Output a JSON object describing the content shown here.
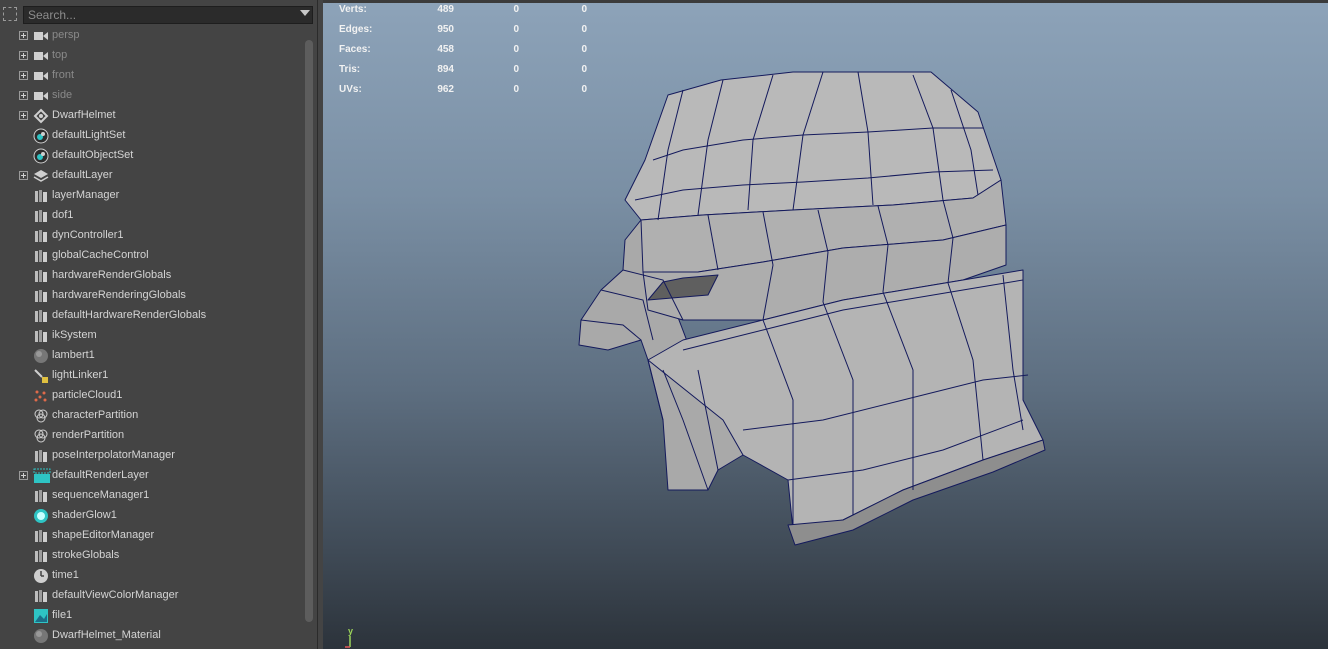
{
  "search": {
    "placeholder": "Search..."
  },
  "outliner": {
    "items": [
      {
        "label": "persp",
        "icon": "camera-icon",
        "expandable": true,
        "dim": true
      },
      {
        "label": "top",
        "icon": "camera-icon",
        "expandable": true,
        "dim": true
      },
      {
        "label": "front",
        "icon": "camera-icon",
        "expandable": true,
        "dim": true
      },
      {
        "label": "side",
        "icon": "camera-icon",
        "expandable": true,
        "dim": true
      },
      {
        "label": "DwarfHelmet",
        "icon": "transform-icon",
        "expandable": true,
        "dim": false
      },
      {
        "label": "defaultLightSet",
        "icon": "set-icon",
        "expandable": false,
        "dim": false
      },
      {
        "label": "defaultObjectSet",
        "icon": "set-icon",
        "expandable": false,
        "dim": false
      },
      {
        "label": "defaultLayer",
        "icon": "layer-icon",
        "expandable": true,
        "dim": false
      },
      {
        "label": "layerManager",
        "icon": "node-icon",
        "expandable": false,
        "dim": false
      },
      {
        "label": "dof1",
        "icon": "node-icon",
        "expandable": false,
        "dim": false
      },
      {
        "label": "dynController1",
        "icon": "node-icon",
        "expandable": false,
        "dim": false
      },
      {
        "label": "globalCacheControl",
        "icon": "node-icon",
        "expandable": false,
        "dim": false
      },
      {
        "label": "hardwareRenderGlobals",
        "icon": "node-icon",
        "expandable": false,
        "dim": false
      },
      {
        "label": "hardwareRenderingGlobals",
        "icon": "node-icon",
        "expandable": false,
        "dim": false
      },
      {
        "label": "defaultHardwareRenderGlobals",
        "icon": "node-icon",
        "expandable": false,
        "dim": false
      },
      {
        "label": "ikSystem",
        "icon": "node-icon",
        "expandable": false,
        "dim": false
      },
      {
        "label": "lambert1",
        "icon": "material-icon",
        "expandable": false,
        "dim": false
      },
      {
        "label": "lightLinker1",
        "icon": "light-linker-icon",
        "expandable": false,
        "dim": false
      },
      {
        "label": "particleCloud1",
        "icon": "particle-icon",
        "expandable": false,
        "dim": false
      },
      {
        "label": "characterPartition",
        "icon": "partition-icon",
        "expandable": false,
        "dim": false
      },
      {
        "label": "renderPartition",
        "icon": "partition-icon",
        "expandable": false,
        "dim": false
      },
      {
        "label": "poseInterpolatorManager",
        "icon": "node-icon",
        "expandable": false,
        "dim": false
      },
      {
        "label": "defaultRenderLayer",
        "icon": "render-layer-icon",
        "expandable": true,
        "dim": false
      },
      {
        "label": "sequenceManager1",
        "icon": "node-icon",
        "expandable": false,
        "dim": false
      },
      {
        "label": "shaderGlow1",
        "icon": "glow-icon",
        "expandable": false,
        "dim": false
      },
      {
        "label": "shapeEditorManager",
        "icon": "node-icon",
        "expandable": false,
        "dim": false
      },
      {
        "label": "strokeGlobals",
        "icon": "node-icon",
        "expandable": false,
        "dim": false
      },
      {
        "label": "time1",
        "icon": "clock-icon",
        "expandable": false,
        "dim": false
      },
      {
        "label": "defaultViewColorManager",
        "icon": "node-icon",
        "expandable": false,
        "dim": false
      },
      {
        "label": "file1",
        "icon": "file-texture-icon",
        "expandable": false,
        "dim": false
      },
      {
        "label": "DwarfHelmet_Material",
        "icon": "material-icon",
        "expandable": false,
        "dim": false
      }
    ]
  },
  "hud": {
    "rows": [
      {
        "label": "Verts:",
        "v1": "489",
        "v2": "0",
        "v3": "0"
      },
      {
        "label": "Edges:",
        "v1": "950",
        "v2": "0",
        "v3": "0"
      },
      {
        "label": "Faces:",
        "v1": "458",
        "v2": "0",
        "v3": "0"
      },
      {
        "label": "Tris:",
        "v1": "894",
        "v2": "0",
        "v3": "0"
      },
      {
        "label": "UVs:",
        "v1": "962",
        "v2": "0",
        "v3": "0"
      }
    ]
  },
  "axis": {
    "y_label": "y"
  },
  "colors": {
    "accent_teal": "#2ec4c4",
    "wire": "#141a5c",
    "mesh": "#b6b6b6"
  }
}
